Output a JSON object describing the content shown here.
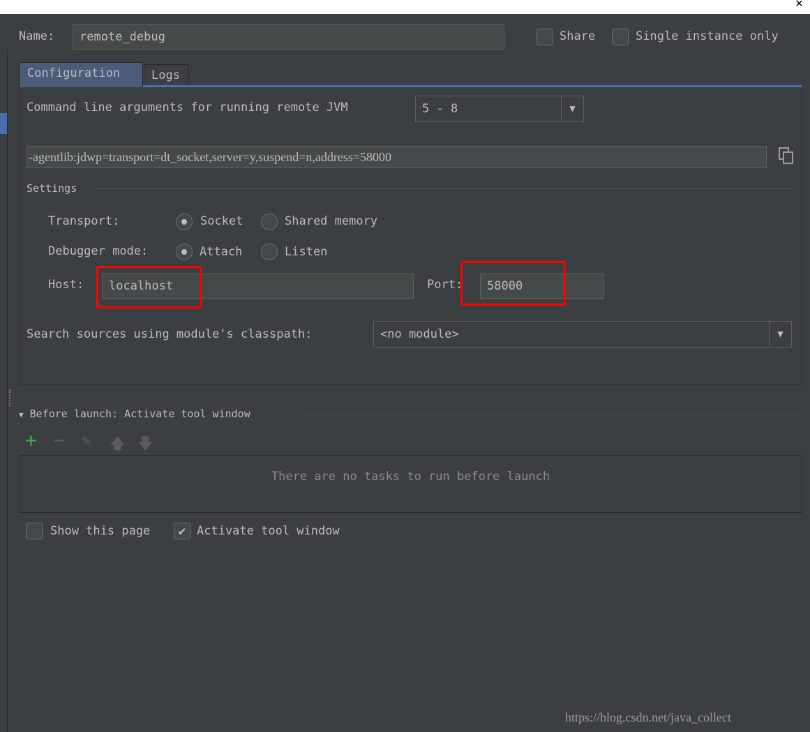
{
  "name": {
    "label": "Name:",
    "value": "remote_debug"
  },
  "share": {
    "label": "Share",
    "checked": false
  },
  "single_instance": {
    "label": "Single instance only",
    "checked": false
  },
  "tabs": [
    {
      "label": "Configuration",
      "active": true
    },
    {
      "label": "Logs",
      "active": false
    }
  ],
  "cmdline": {
    "label": "Command line arguments for running remote JVM",
    "jvm_version": "5 - 8",
    "value": "-agentlib:jdwp=transport=dt_socket,server=y,suspend=n,address=58000"
  },
  "settings": {
    "title": "Settings",
    "transport": {
      "label": "Transport:",
      "options": [
        "Socket",
        "Shared memory"
      ],
      "selected": "Socket"
    },
    "debugger_mode": {
      "label": "Debugger mode:",
      "options": [
        "Attach",
        "Listen"
      ],
      "selected": "Attach"
    },
    "host": {
      "label": "Host:",
      "value": "localhost"
    },
    "port": {
      "label": "Port:",
      "value": "58000"
    },
    "module": {
      "label": "Search sources using module's classpath:",
      "value": "<no module>"
    }
  },
  "before_launch": {
    "title": "Before launch: Activate tool window",
    "empty_text": "There are no tasks to run before launch"
  },
  "show_page": {
    "label": "Show this page",
    "checked": false
  },
  "activate_tool": {
    "label": "Activate tool window",
    "checked": true
  },
  "watermark": "https://blog.csdn.net/java_collect",
  "colors": {
    "background": "#3c3f41",
    "accent": "#4b6eaf",
    "highlight": "#ff0000",
    "add": "#3cb043"
  }
}
